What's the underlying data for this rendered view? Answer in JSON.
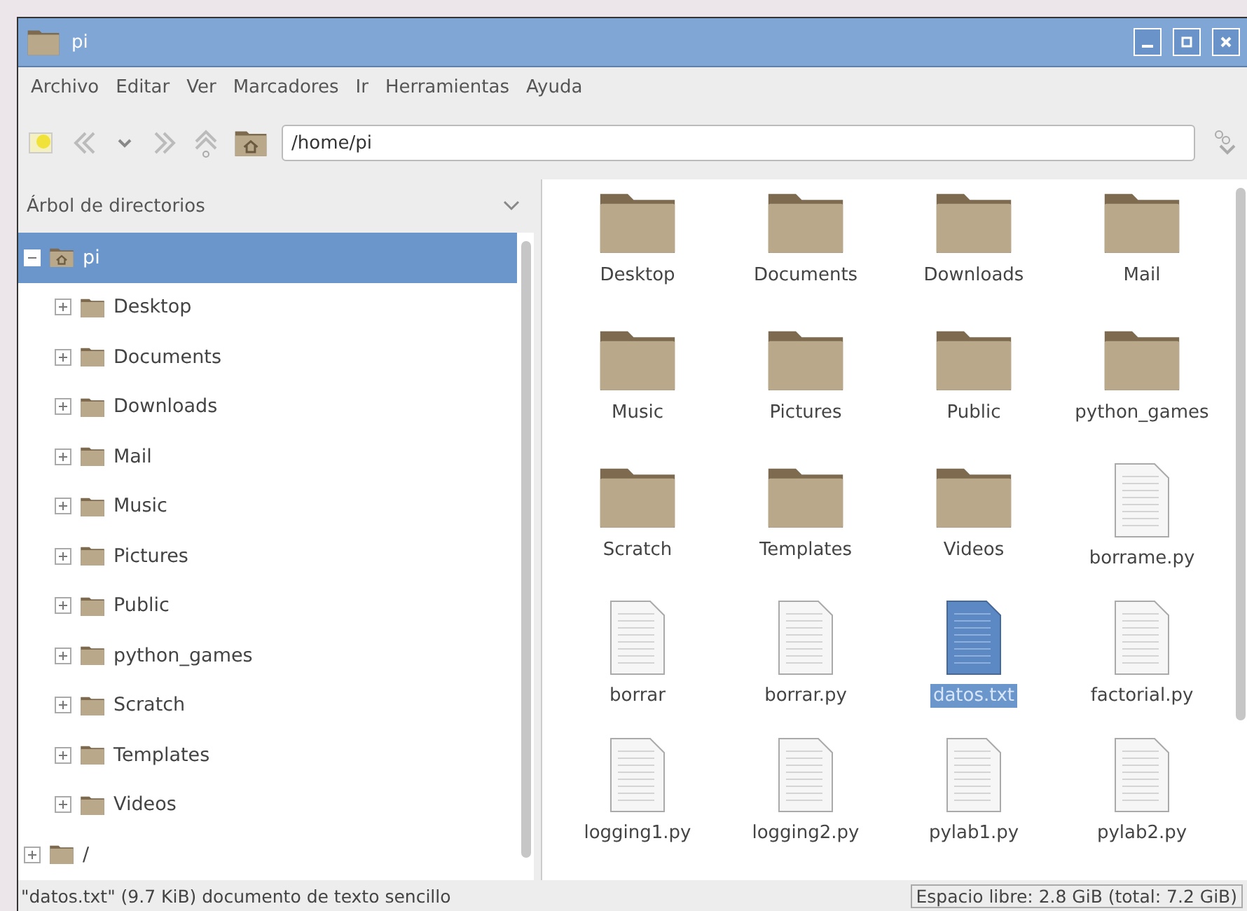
{
  "window": {
    "title": "pi"
  },
  "menu": [
    "Archivo",
    "Editar",
    "Ver",
    "Marcadores",
    "Ir",
    "Herramientas",
    "Ayuda"
  ],
  "location": {
    "value": "/home/pi"
  },
  "sidebar": {
    "title": "Árbol de directorios",
    "tree": [
      {
        "label": "pi",
        "kind": "home",
        "expanded": true,
        "selected": true,
        "children": [
          {
            "label": "Desktop",
            "kind": "folder",
            "expanded": false,
            "selected": false
          },
          {
            "label": "Documents",
            "kind": "folder",
            "expanded": false,
            "selected": false
          },
          {
            "label": "Downloads",
            "kind": "folder",
            "expanded": false,
            "selected": false
          },
          {
            "label": "Mail",
            "kind": "folder",
            "expanded": false,
            "selected": false
          },
          {
            "label": "Music",
            "kind": "folder",
            "expanded": false,
            "selected": false
          },
          {
            "label": "Pictures",
            "kind": "folder",
            "expanded": false,
            "selected": false
          },
          {
            "label": "Public",
            "kind": "folder",
            "expanded": false,
            "selected": false
          },
          {
            "label": "python_games",
            "kind": "folder",
            "expanded": false,
            "selected": false
          },
          {
            "label": "Scratch",
            "kind": "folder",
            "expanded": false,
            "selected": false
          },
          {
            "label": "Templates",
            "kind": "folder",
            "expanded": false,
            "selected": false
          },
          {
            "label": "Videos",
            "kind": "folder",
            "expanded": false,
            "selected": false
          }
        ]
      },
      {
        "label": "/",
        "kind": "folder",
        "expanded": false,
        "selected": false
      }
    ]
  },
  "files": [
    {
      "name": "Desktop",
      "kind": "folder",
      "selected": false
    },
    {
      "name": "Documents",
      "kind": "folder",
      "selected": false
    },
    {
      "name": "Downloads",
      "kind": "folder",
      "selected": false
    },
    {
      "name": "Mail",
      "kind": "folder",
      "selected": false
    },
    {
      "name": "Music",
      "kind": "folder",
      "selected": false
    },
    {
      "name": "Pictures",
      "kind": "folder",
      "selected": false
    },
    {
      "name": "Public",
      "kind": "folder",
      "selected": false
    },
    {
      "name": "python_games",
      "kind": "folder",
      "selected": false
    },
    {
      "name": "Scratch",
      "kind": "folder",
      "selected": false
    },
    {
      "name": "Templates",
      "kind": "folder",
      "selected": false
    },
    {
      "name": "Videos",
      "kind": "folder",
      "selected": false
    },
    {
      "name": "borrame.py",
      "kind": "file",
      "selected": false
    },
    {
      "name": "borrar",
      "kind": "file",
      "selected": false
    },
    {
      "name": "borrar.py",
      "kind": "file",
      "selected": false
    },
    {
      "name": "datos.txt",
      "kind": "file",
      "selected": true
    },
    {
      "name": "factorial.py",
      "kind": "file",
      "selected": false
    },
    {
      "name": "logging1.py",
      "kind": "file",
      "selected": false
    },
    {
      "name": "logging2.py",
      "kind": "file",
      "selected": false
    },
    {
      "name": "pylab1.py",
      "kind": "file",
      "selected": false
    },
    {
      "name": "pylab2.py",
      "kind": "file",
      "selected": false
    }
  ],
  "status_bar": {
    "info": "\"datos.txt\" (9.7 KiB) documento de texto sencillo",
    "free_space": "Espacio libre: 2.8 GiB (total: 7.2 GiB)"
  }
}
